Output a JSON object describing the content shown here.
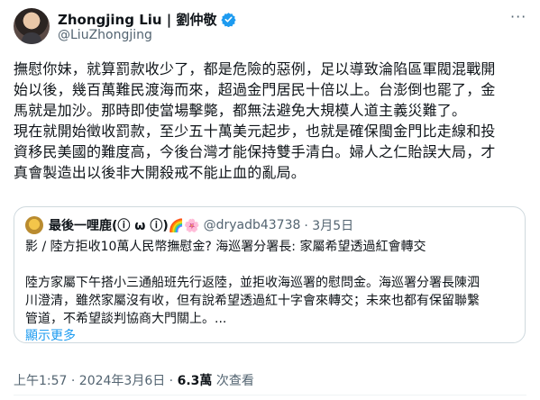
{
  "tweet": {
    "author_name": "Zhongjing Liu | 劉仲敬",
    "handle": "@LiuZhongjing",
    "more_icon": "more-icon",
    "body": "撫慰你妹，就算罰款收少了，都是危險的惡例，足以導致淪陷區軍閥混戰開\n始以後，幾百萬難民渡海而來，超過金門居民十倍以上。台澎倒也罷了，金\n馬就是加沙。那時即使當場擊斃，都無法避免大規模人道主義災難了。\n現在就開始徵收罰款，至少五十萬美元起步，也就是確保閩金門比走線和投\n資移民美國的難度高，今後台灣才能保持雙手清白。婦人之仁貽誤大局，才\n真會製造出以後非大開殺戒不能止血的亂局。",
    "quote": {
      "name": "最後一哩鹿(ⓘ ω ⓘ)🌈🌸",
      "handle": "@dryadb43738",
      "date": "· 3月5日",
      "text": "影 / 陸方拒收10萬人民幣撫慰金? 海巡署分署長: 家屬希望透過紅會轉交\n\n陸方家屬下午搭小三通船班先行返陸，並拒收海巡署的慰問金。海巡署分署長陳泗\n川澄清，雖然家屬沒有收，但有說希望透過紅十字會來轉交；未來也都有保留聯繫\n管道，不希望談判協商大門關上。...",
      "show_more": "顯示更多"
    },
    "timestamp": "上午1:57 · 2024年3月6日 · ",
    "views_count": "6.3萬",
    "views_label": " 次查看"
  },
  "colors": {
    "accent": "#1d9bf0",
    "text": "#0f1419",
    "muted": "#536471"
  }
}
